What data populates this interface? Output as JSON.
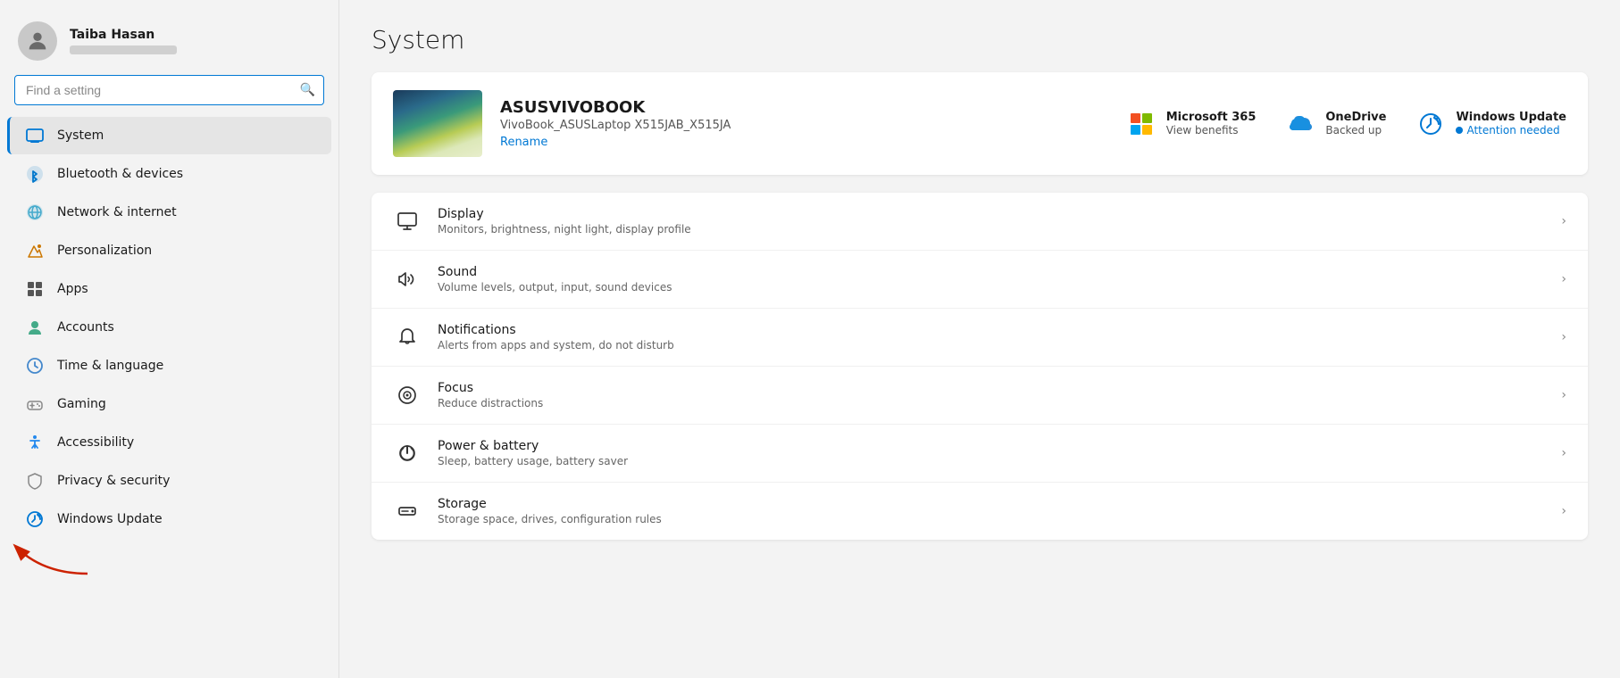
{
  "user": {
    "name": "Taiba Hasan",
    "email": "••••••••••@••••••••"
  },
  "search": {
    "placeholder": "Find a setting"
  },
  "nav": {
    "items": [
      {
        "id": "system",
        "label": "System",
        "icon": "🖥",
        "active": true
      },
      {
        "id": "bluetooth",
        "label": "Bluetooth & devices",
        "icon": "⬡",
        "active": false
      },
      {
        "id": "network",
        "label": "Network & internet",
        "icon": "🌐",
        "active": false
      },
      {
        "id": "personalization",
        "label": "Personalization",
        "icon": "✏",
        "active": false
      },
      {
        "id": "apps",
        "label": "Apps",
        "icon": "📦",
        "active": false
      },
      {
        "id": "accounts",
        "label": "Accounts",
        "icon": "👤",
        "active": false
      },
      {
        "id": "time",
        "label": "Time & language",
        "icon": "🕐",
        "active": false
      },
      {
        "id": "gaming",
        "label": "Gaming",
        "icon": "🎮",
        "active": false
      },
      {
        "id": "accessibility",
        "label": "Accessibility",
        "icon": "♿",
        "active": false
      },
      {
        "id": "privacy",
        "label": "Privacy & security",
        "icon": "🛡",
        "active": false
      },
      {
        "id": "windows-update",
        "label": "Windows Update",
        "icon": "🔄",
        "active": false
      }
    ]
  },
  "page": {
    "title": "System"
  },
  "device": {
    "name": "ASUSVIVOBOOK",
    "model": "VivoBook_ASUSLaptop X515JAB_X515JA",
    "rename_label": "Rename"
  },
  "quick_actions": [
    {
      "id": "microsoft365",
      "title": "Microsoft 365",
      "sub": "View benefits"
    },
    {
      "id": "onedrive",
      "title": "OneDrive",
      "sub": "Backed up"
    },
    {
      "id": "windows-update",
      "title": "Windows Update",
      "sub": "Attention needed",
      "has_dot": true
    }
  ],
  "settings": [
    {
      "id": "display",
      "title": "Display",
      "sub": "Monitors, brightness, night light, display profile",
      "icon": "display"
    },
    {
      "id": "sound",
      "title": "Sound",
      "sub": "Volume levels, output, input, sound devices",
      "icon": "sound"
    },
    {
      "id": "notifications",
      "title": "Notifications",
      "sub": "Alerts from apps and system, do not disturb",
      "icon": "notifications"
    },
    {
      "id": "focus",
      "title": "Focus",
      "sub": "Reduce distractions",
      "icon": "focus"
    },
    {
      "id": "power",
      "title": "Power & battery",
      "sub": "Sleep, battery usage, battery saver",
      "icon": "power"
    },
    {
      "id": "storage",
      "title": "Storage",
      "sub": "Storage space, drives, configuration rules",
      "icon": "storage"
    }
  ]
}
